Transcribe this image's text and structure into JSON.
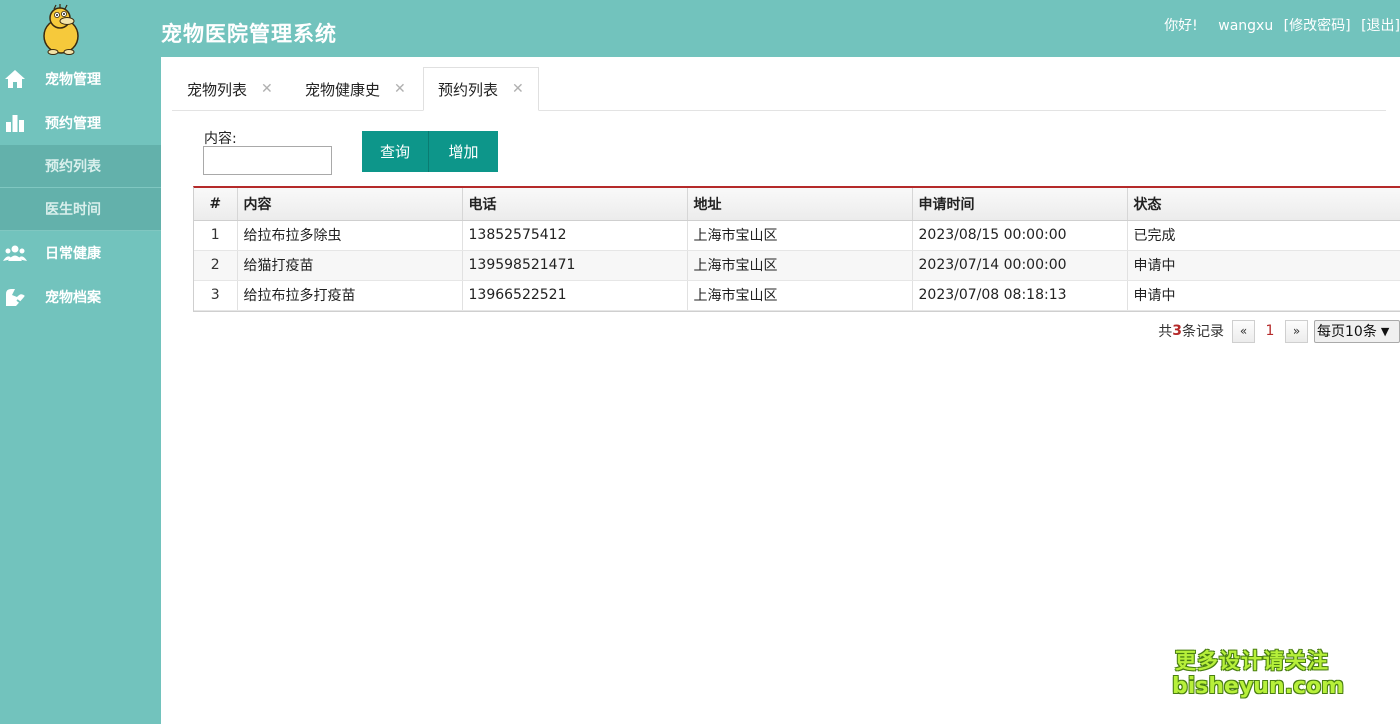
{
  "header": {
    "app_title": "宠物医院管理系统",
    "greeting": "你好!",
    "username": "wangxu",
    "change_password": "[修改密码]",
    "logout": "[退出]"
  },
  "sidebar": {
    "items": [
      {
        "icon": "home-icon",
        "label": "宠物管理"
      },
      {
        "icon": "bar-chart-icon",
        "label": "预约管理",
        "children": [
          {
            "label": "预约列表"
          },
          {
            "label": "医生时间"
          }
        ]
      },
      {
        "icon": "people-icon",
        "label": "日常健康"
      },
      {
        "icon": "pet-record-icon",
        "label": "宠物档案"
      }
    ]
  },
  "tabs": [
    {
      "label": "宠物列表",
      "close": "✕",
      "active": false
    },
    {
      "label": "宠物健康史",
      "close": "✕",
      "active": false
    },
    {
      "label": "预约列表",
      "close": "✕",
      "active": true
    }
  ],
  "search": {
    "label": "内容:",
    "value": "",
    "query_button": "查询",
    "add_button": "增加"
  },
  "table": {
    "columns": [
      "#",
      "内容",
      "电话",
      "地址",
      "申请时间",
      "状态"
    ],
    "rows": [
      [
        "1",
        "给拉布拉多除虫",
        "13852575412",
        "上海市宝山区",
        "2023/08/15 00:00:00",
        "已完成"
      ],
      [
        "2",
        "给猫打疫苗",
        "139598521471",
        "上海市宝山区",
        "2023/07/14 00:00:00",
        "申请中"
      ],
      [
        "3",
        "给拉布拉多打疫苗",
        "13966522521",
        "上海市宝山区",
        "2023/07/08 08:18:13",
        "申请中"
      ]
    ]
  },
  "pager": {
    "prefix": "共",
    "total": "3",
    "suffix": "条记录",
    "prev": "«",
    "current_page": "1",
    "next": "»",
    "page_size": "每页10条"
  },
  "watermark": {
    "line1": "更多设计请关注",
    "line2": "bisheyun.com"
  },
  "colors": {
    "header_bg": "#72c3bd",
    "button_bg": "#0d968a",
    "table_accent": "#b52a2a"
  }
}
